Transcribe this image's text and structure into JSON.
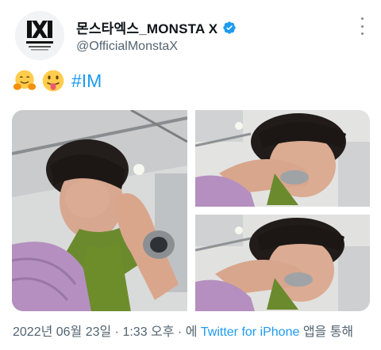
{
  "account": {
    "display_name": "몬스타엑스_MONSTA X",
    "handle": "@OfficialMonstaX",
    "avatar_logo_text": "MONSTA X",
    "avatar_sub_text": "OFFICIAL TWITTER"
  },
  "tweet": {
    "emojis": [
      "hugging-face-emoji",
      "tongue-out-emoji"
    ],
    "hashtag": "#IM"
  },
  "meta": {
    "timestamp": "2022년 06월 23일 · 1:33 오후 · 에",
    "source": "Twitter for iPhone",
    "source_suffix": "앱을 통해"
  },
  "colors": {
    "link": "#1d9bf0",
    "verified": "#1d9bf0",
    "secondary_text": "#536471"
  },
  "icons": {
    "verified": "verified-badge-icon",
    "more": "more-options-icon"
  }
}
